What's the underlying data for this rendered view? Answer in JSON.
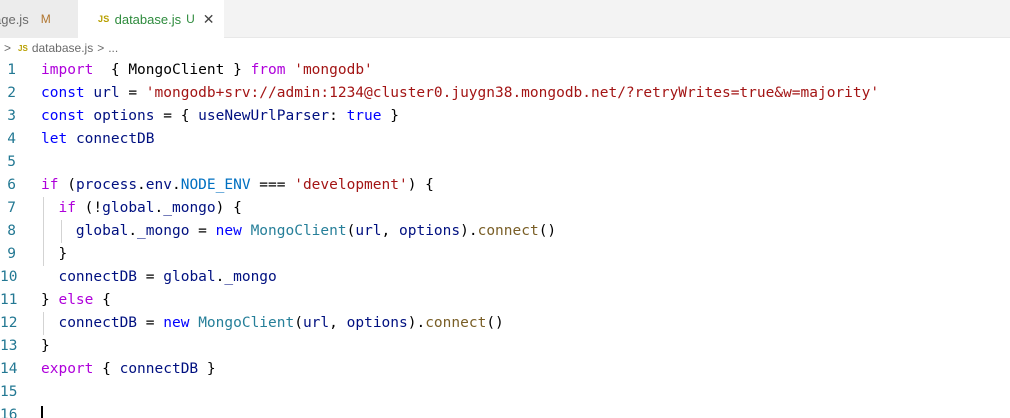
{
  "tabs": [
    {
      "name": "page.js",
      "display": "page.js",
      "status": "M"
    },
    {
      "name": "database.js",
      "status": "U",
      "icon": "JS"
    }
  ],
  "breadcrumb": {
    "icon": "JS",
    "file": "database.js",
    "more": "..."
  },
  "editor": {
    "lines": [
      {
        "n": "1",
        "tokens": [
          [
            "kw2",
            "import"
          ],
          [
            "",
            "  "
          ],
          [
            "",
            "{ "
          ],
          [
            "",
            "MongoClient"
          ],
          [
            "",
            " } "
          ],
          [
            "kw2",
            "from"
          ],
          [
            "",
            " "
          ],
          [
            "str",
            "'mongodb'"
          ]
        ]
      },
      {
        "n": "2",
        "tokens": [
          [
            "kw",
            "const"
          ],
          [
            "",
            " "
          ],
          [
            "var",
            "url"
          ],
          [
            "",
            " = "
          ],
          [
            "str",
            "'mongodb+srv://admin:1234@cluster0.juygn38.mongodb.net/?retryWrites=true&w=majority'"
          ]
        ]
      },
      {
        "n": "3",
        "tokens": [
          [
            "kw",
            "const"
          ],
          [
            "",
            " "
          ],
          [
            "var",
            "options"
          ],
          [
            "",
            " = { "
          ],
          [
            "var",
            "useNewUrlParser"
          ],
          [
            "",
            ": "
          ],
          [
            "kw",
            "true"
          ],
          [
            "",
            " }"
          ]
        ]
      },
      {
        "n": "4",
        "tokens": [
          [
            "kw",
            "let"
          ],
          [
            "",
            " "
          ],
          [
            "var",
            "connectDB"
          ]
        ]
      },
      {
        "n": "5",
        "tokens": []
      },
      {
        "n": "6",
        "tokens": [
          [
            "kw2",
            "if"
          ],
          [
            "",
            " ("
          ],
          [
            "var",
            "process"
          ],
          [
            "",
            "."
          ],
          [
            "var",
            "env"
          ],
          [
            "",
            "."
          ],
          [
            "const",
            "NODE_ENV"
          ],
          [
            "",
            " === "
          ],
          [
            "str",
            "'development'"
          ],
          [
            "",
            ") {"
          ]
        ]
      },
      {
        "n": "7",
        "tokens": [
          [
            "",
            "  "
          ],
          [
            "kw2",
            "if"
          ],
          [
            "",
            " (!"
          ],
          [
            "var",
            "global"
          ],
          [
            "",
            "."
          ],
          [
            "var",
            "_mongo"
          ],
          [
            "",
            ") {"
          ]
        ]
      },
      {
        "n": "8",
        "tokens": [
          [
            "",
            "    "
          ],
          [
            "var",
            "global"
          ],
          [
            "",
            "."
          ],
          [
            "var",
            "_mongo"
          ],
          [
            "",
            " = "
          ],
          [
            "kw",
            "new"
          ],
          [
            "",
            " "
          ],
          [
            "cls",
            "MongoClient"
          ],
          [
            "",
            "("
          ],
          [
            "var",
            "url"
          ],
          [
            "",
            ", "
          ],
          [
            "var",
            "options"
          ],
          [
            "",
            ")."
          ],
          [
            "fn",
            "connect"
          ],
          [
            "",
            "()"
          ]
        ]
      },
      {
        "n": "9",
        "tokens": [
          [
            "",
            "  }"
          ]
        ]
      },
      {
        "n": "10",
        "tokens": [
          [
            "",
            "  "
          ],
          [
            "var",
            "connectDB"
          ],
          [
            "",
            " = "
          ],
          [
            "var",
            "global"
          ],
          [
            "",
            "."
          ],
          [
            "var",
            "_mongo"
          ]
        ]
      },
      {
        "n": "11",
        "tokens": [
          [
            "",
            "} "
          ],
          [
            "kw2",
            "else"
          ],
          [
            "",
            " {"
          ]
        ]
      },
      {
        "n": "12",
        "tokens": [
          [
            "",
            "  "
          ],
          [
            "var",
            "connectDB"
          ],
          [
            "",
            " = "
          ],
          [
            "kw",
            "new"
          ],
          [
            "",
            " "
          ],
          [
            "cls",
            "MongoClient"
          ],
          [
            "",
            "("
          ],
          [
            "var",
            "url"
          ],
          [
            "",
            ", "
          ],
          [
            "var",
            "options"
          ],
          [
            "",
            ")."
          ],
          [
            "fn",
            "connect"
          ],
          [
            "",
            "()"
          ]
        ]
      },
      {
        "n": "13",
        "tokens": [
          [
            "",
            "}"
          ]
        ]
      },
      {
        "n": "14",
        "tokens": [
          [
            "kw2",
            "export"
          ],
          [
            "",
            " { "
          ],
          [
            "var",
            "connectDB"
          ],
          [
            "",
            " }"
          ]
        ]
      },
      {
        "n": "15",
        "tokens": []
      },
      {
        "n": "16",
        "tokens": []
      }
    ]
  },
  "colors": {
    "accent": "#2e8b3d",
    "line_number": "#237893"
  }
}
